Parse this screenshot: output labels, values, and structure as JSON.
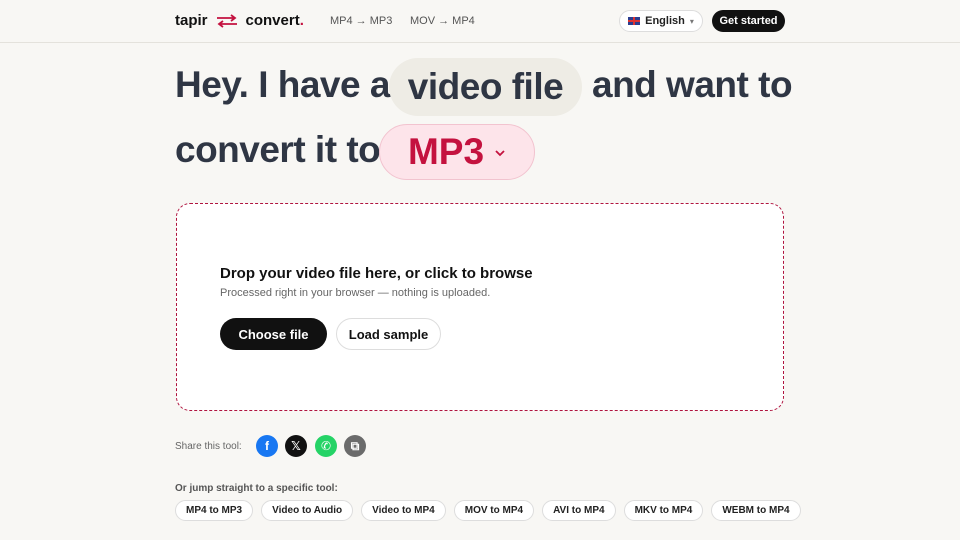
{
  "header": {
    "logo": {
      "left": "tapir",
      "right": "convert",
      "dot": "."
    },
    "nav": [
      "MP4 → MP3",
      "MOV → MP4"
    ],
    "language": "English",
    "cta": "Get started"
  },
  "hero": {
    "line1_prefix": "Hey. I have a",
    "source_type": "video file",
    "line1_suffix": "and want to",
    "line2_prefix": "convert it to",
    "target_format": "MP3"
  },
  "dropzone": {
    "title": "Drop your video file here, or click to browse",
    "subtitle": "Processed right in your browser — nothing is uploaded.",
    "choose_label": "Choose file",
    "sample_label": "Load sample"
  },
  "share": {
    "label": "Share this tool:",
    "buttons": [
      {
        "icon": "facebook-icon",
        "glyph": "f",
        "color": "#1877f2"
      },
      {
        "icon": "x-icon",
        "glyph": "𝕏",
        "color": "#111111"
      },
      {
        "icon": "whatsapp-icon",
        "glyph": "✆",
        "color": "#25d366"
      },
      {
        "icon": "copy-icon",
        "glyph": "⧉",
        "color": "#6b6b6b"
      }
    ]
  },
  "jump": {
    "label": "Or jump straight to a specific tool:",
    "tools": [
      "MP4 to MP3",
      "Video to Audio",
      "Video to MP4",
      "MOV to MP4",
      "AVI to MP4",
      "MKV to MP4",
      "WEBM to MP4"
    ]
  },
  "colors": {
    "accent": "#c4123f",
    "dark": "#111111",
    "background": "#f8f7f4"
  }
}
